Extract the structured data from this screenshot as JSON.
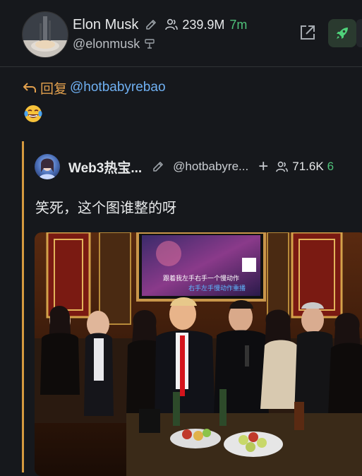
{
  "author": {
    "display_name": "Elon Musk",
    "handle": "@elonmusk",
    "followers": "239.9M",
    "age": "7m"
  },
  "reply": {
    "label": "回复",
    "to_handle": "@hotbabyrebao",
    "emoji": "😂"
  },
  "quoted": {
    "display_name": "Web3热宝...",
    "handle": "@hotbabyre...",
    "followers": "71.6K",
    "age": "6",
    "text": "笑死，这个图谁整的呀",
    "image": {
      "screen_line1": "跟着我左手右手一个慢动作",
      "screen_line2": "右手左手慢动作重播"
    }
  },
  "colors": {
    "background": "#16181c",
    "reply_accent": "#e2a04d",
    "link": "#6fb0f2",
    "age_green": "#4fc27a",
    "quote_bar": "#d69a3f"
  }
}
